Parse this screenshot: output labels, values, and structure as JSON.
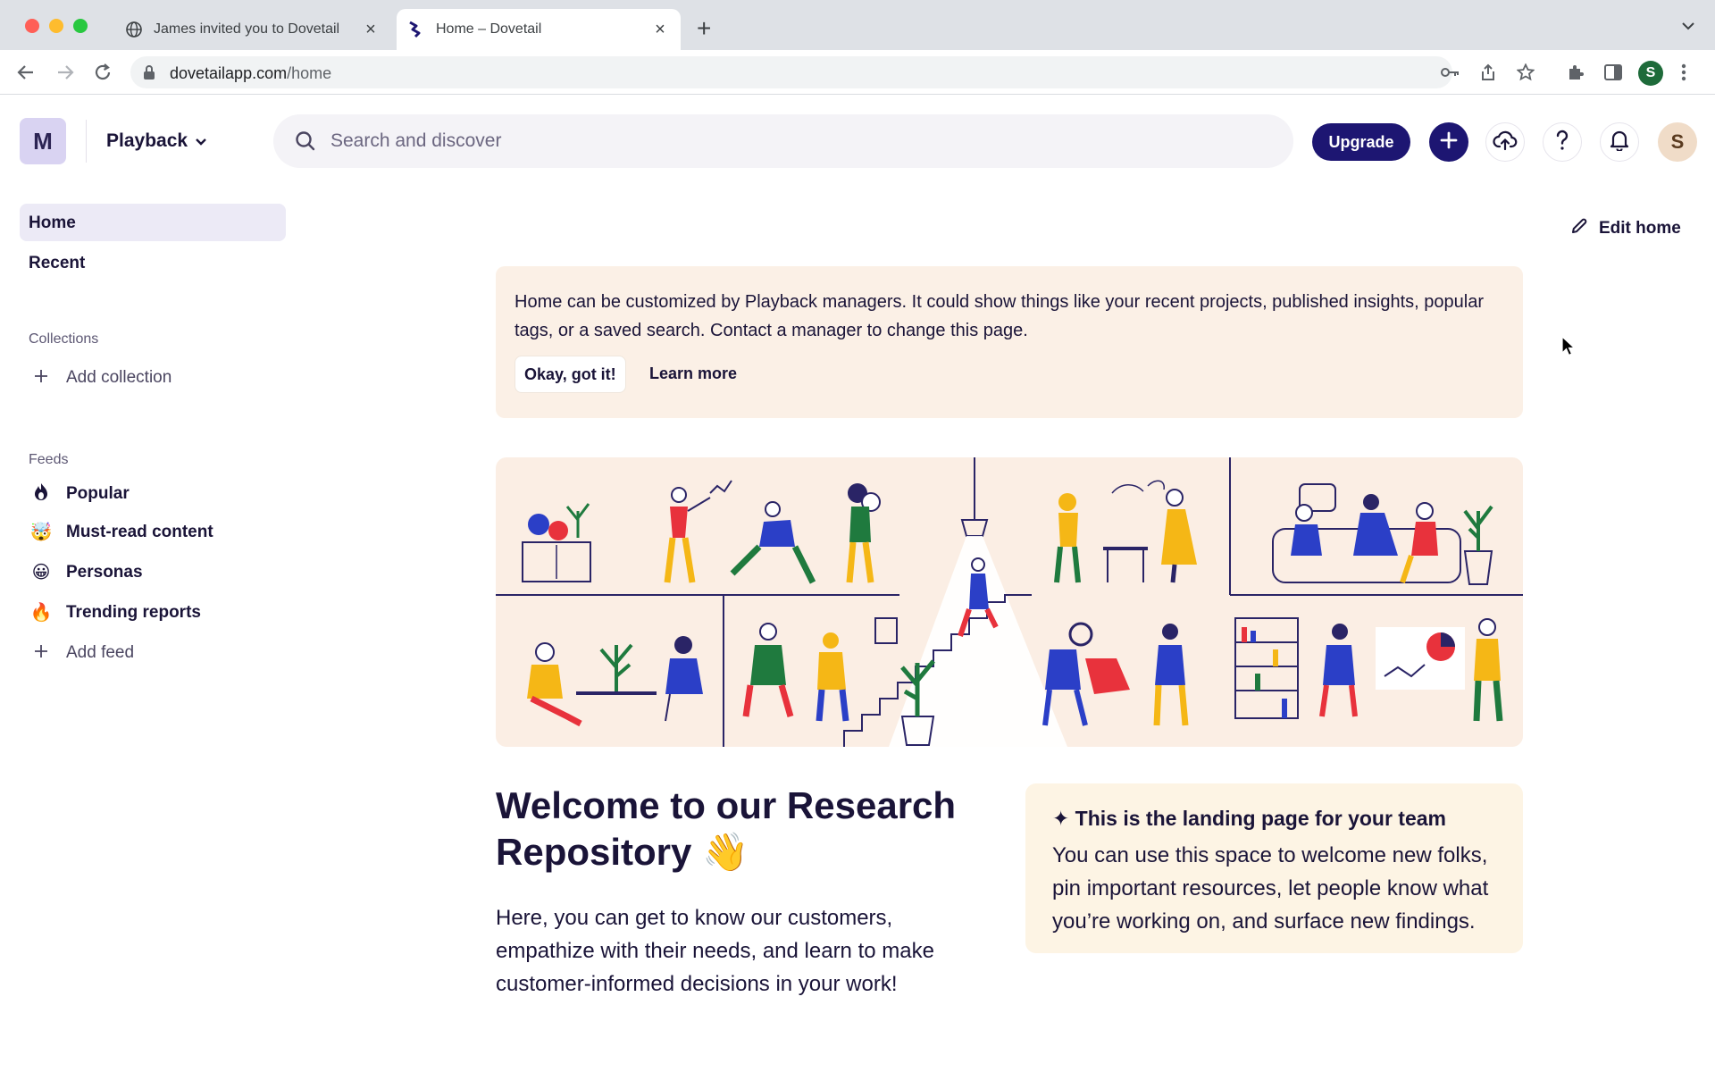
{
  "browser": {
    "tabs": [
      {
        "title": "James invited you to Dovetail",
        "active": false,
        "favicon": "globe-icon"
      },
      {
        "title": "Home – Dovetail",
        "active": true,
        "favicon": "dovetail-logo-icon"
      }
    ],
    "url_host": "dovetailapp.com",
    "url_path": "/home",
    "profile_initial": "S"
  },
  "header": {
    "workspace_initial": "M",
    "workspace_name": "Playback",
    "search_placeholder": "Search and discover",
    "upgrade_label": "Upgrade",
    "user_initial": "S"
  },
  "sidebar": {
    "nav": [
      {
        "label": "Home",
        "active": true
      },
      {
        "label": "Recent",
        "active": false
      }
    ],
    "collections_heading": "Collections",
    "add_collection_label": "Add collection",
    "feeds_heading": "Feeds",
    "feeds": [
      {
        "label": "Popular",
        "icon": "flame-dark-icon"
      },
      {
        "label": "Must-read content",
        "icon": "mind-blown-emoji-icon"
      },
      {
        "label": "Personas",
        "icon": "grinning-face-emoji-icon"
      },
      {
        "label": "Trending reports",
        "icon": "fire-emoji-icon"
      }
    ],
    "add_feed_label": "Add feed"
  },
  "main": {
    "edit_home_label": "Edit home",
    "banner": {
      "text": "Home can be customized by Playback managers. It could show things like your recent projects, published insights, popular tags, or a saved search. Contact a manager to change this page.",
      "okay_label": "Okay, got it!",
      "learn_more_label": "Learn more"
    },
    "welcome_title": "Welcome to our Research Repository 👋",
    "intro_text": "Here, you can get to know our customers, empathize with their needs, and learn to make customer-informed decisions in your work!",
    "callout": {
      "title": "✦ This is the landing page for your team",
      "body": "You can use this space to welcome new folks, pin important resources, let people know what you’re working on, and surface new findings."
    }
  },
  "colors": {
    "brand_navy": "#1d1672",
    "banner_bg": "#fbf0e6",
    "callout_bg": "#fdf4e4",
    "sidebar_active_bg": "#eceaf6"
  }
}
